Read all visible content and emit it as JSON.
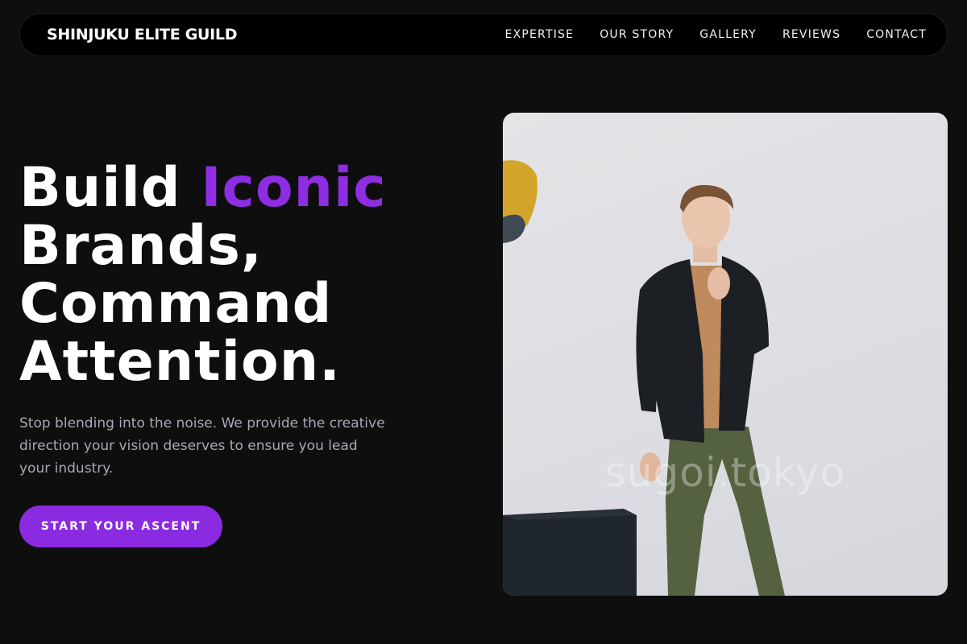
{
  "nav": {
    "brand": "SHINJUKU ELITE GUILD",
    "links": [
      "EXPERTISE",
      "OUR STORY",
      "GALLERY",
      "REVIEWS",
      "CONTACT"
    ]
  },
  "hero": {
    "headline": {
      "word1": "Build ",
      "accent": "Iconic",
      "line2": "Brands,",
      "line3": "Command",
      "line4": "Attention."
    },
    "subtext": "Stop blending into the noise. We provide the creative direction your vision deserves to ensure you lead your industry.",
    "cta_label": "START YOUR ASCENT",
    "image_watermark": "sugoi.tokyo"
  },
  "colors": {
    "background": "#0e0e0f",
    "accent": "#8a2be2",
    "nav_bg": "#000000",
    "subtext": "#a7a9b4"
  }
}
